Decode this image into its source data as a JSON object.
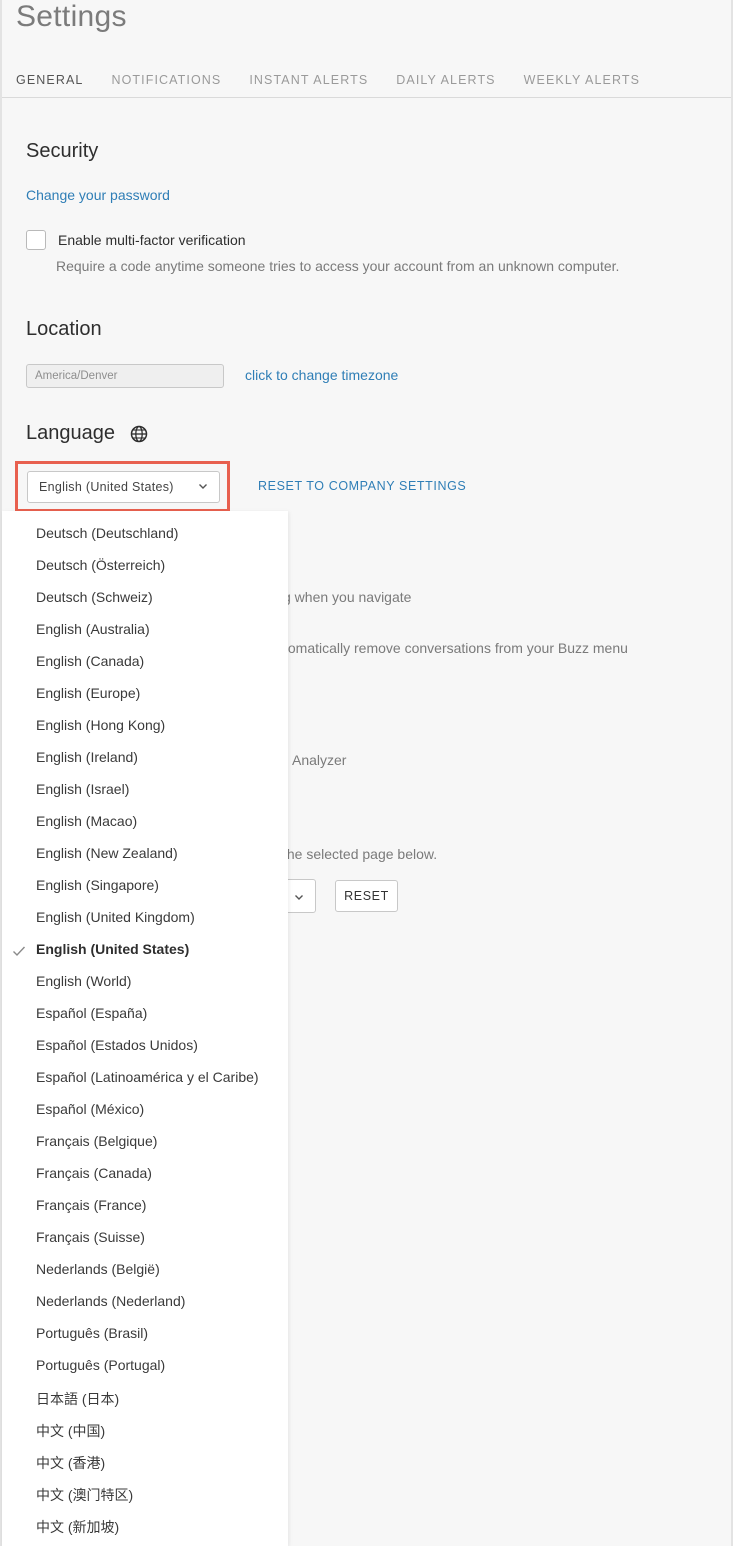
{
  "page": {
    "title": "Settings"
  },
  "tabs": [
    {
      "label": "GENERAL",
      "active": true
    },
    {
      "label": "NOTIFICATIONS",
      "active": false
    },
    {
      "label": "INSTANT ALERTS",
      "active": false
    },
    {
      "label": "DAILY ALERTS",
      "active": false
    },
    {
      "label": "WEEKLY ALERTS",
      "active": false
    }
  ],
  "security": {
    "heading": "Security",
    "change_password_link": "Change your password",
    "mfa": {
      "label": "Enable multi-factor verification",
      "checked": false,
      "help": "Require a code anytime someone tries to access your account from an unknown computer."
    }
  },
  "location": {
    "heading": "Location",
    "timezone_value": "America/Denver",
    "change_timezone_link": "click to change timezone"
  },
  "language": {
    "heading": "Language",
    "icon": "globe-icon",
    "selected": "English (United States)",
    "reset_link": "RESET TO COMPANY SETTINGS",
    "options": [
      "Deutsch (Deutschland)",
      "Deutsch (Österreich)",
      "Deutsch (Schweiz)",
      "English (Australia)",
      "English (Canada)",
      "English (Europe)",
      "English (Hong Kong)",
      "English (Ireland)",
      "English (Israel)",
      "English (Macao)",
      "English (New Zealand)",
      "English (Singapore)",
      "English (United Kingdom)",
      "English (United States)",
      "English (World)",
      "Español (España)",
      "Español (Estados Unidos)",
      "Español (Latinoamérica y el Caribe)",
      "Español (México)",
      "Français (Belgique)",
      "Français (Canada)",
      "Français (France)",
      "Français (Suisse)",
      "Nederlands (België)",
      "Nederlands (Nederland)",
      "Português (Brasil)",
      "Português (Portugal)",
      "日本語 (日本)",
      "中文 (中国)",
      "中文 (香港)",
      "中文 (澳门特区)",
      "中文 (新加坡)"
    ]
  },
  "obscured": {
    "text_navigate": "g when you navigate",
    "text_buzz": "tomatically remove conversations from your Buzz menu",
    "text_analyzer": "Analyzer",
    "text_selected_page": "the selected page below.",
    "reset_button": "RESET"
  },
  "colors": {
    "accent_link": "#2f7eb6",
    "highlight_border": "#e8604f",
    "background": "#f7f7f7"
  }
}
